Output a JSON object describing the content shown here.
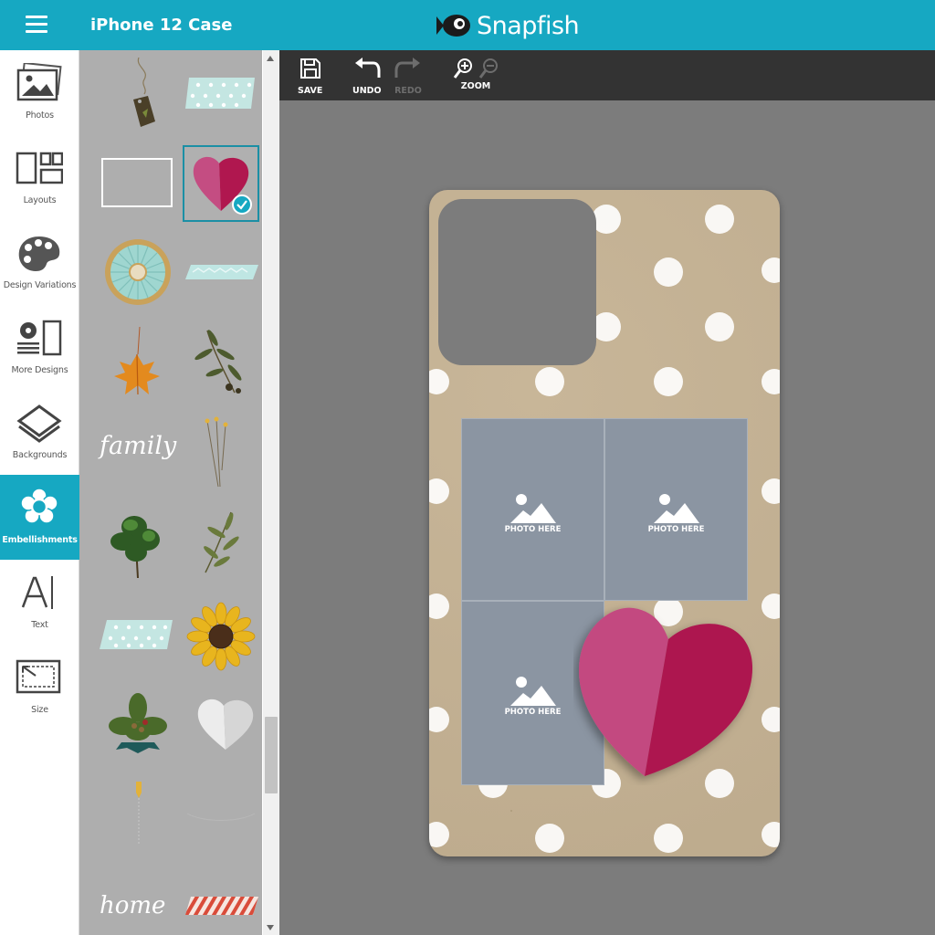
{
  "header": {
    "title": "iPhone 12 Case",
    "logo_text": "Snapfish",
    "brand_color": "#16a8c2"
  },
  "rail": {
    "items": [
      {
        "label": "Photos",
        "icon": "photos-icon"
      },
      {
        "label": "Layouts",
        "icon": "layouts-icon"
      },
      {
        "label": "Design Variations",
        "icon": "palette-icon"
      },
      {
        "label": "More Designs",
        "icon": "more-designs-icon"
      },
      {
        "label": "Backgrounds",
        "icon": "backgrounds-icon"
      },
      {
        "label": "Embellishments",
        "icon": "flower-icon",
        "active": true
      },
      {
        "label": "Text",
        "icon": "text-icon"
      },
      {
        "label": "Size",
        "icon": "size-icon"
      }
    ]
  },
  "panel": {
    "script_family": "family",
    "script_home": "home"
  },
  "toolbar": {
    "save": "SAVE",
    "undo": "UNDO",
    "redo": "REDO",
    "zoom": "ZOOM"
  },
  "canvas": {
    "photo_label": "PHOTO HERE"
  }
}
